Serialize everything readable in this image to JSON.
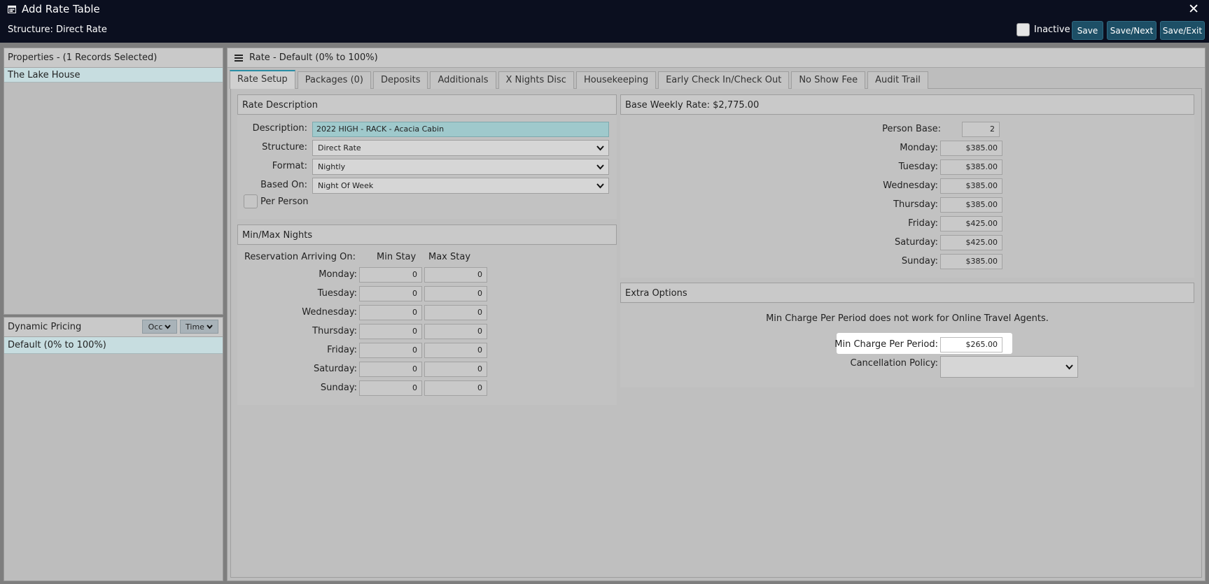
{
  "window": {
    "title": "Add Rate Table",
    "subtitle": "Structure: Direct Rate",
    "inactive_label": "Inactive",
    "buttons": {
      "save": "Save",
      "save_next": "Save/Next",
      "save_exit": "Save/Exit"
    }
  },
  "properties": {
    "header": "Properties - (1 Records Selected)",
    "items": [
      "The Lake House"
    ]
  },
  "dynamic_pricing": {
    "header": "Dynamic Pricing",
    "occ_label": "Occ",
    "time_label": "Time",
    "items": [
      "Default (0% to 100%)"
    ]
  },
  "main": {
    "header": "Rate - Default (0% to 100%)",
    "tabs": [
      "Rate Setup",
      "Packages (0)",
      "Deposits",
      "Additionals",
      "X Nights Disc",
      "Housekeeping",
      "Early Check In/Check Out",
      "No Show Fee",
      "Audit Trail"
    ]
  },
  "rate_description": {
    "header": "Rate Description",
    "description_label": "Description:",
    "description_value": "2022 HIGH - RACK - Acacia Cabin",
    "structure_label": "Structure:",
    "structure_value": "Direct Rate",
    "format_label": "Format:",
    "format_value": "Nightly",
    "based_on_label": "Based On:",
    "based_on_value": "Night Of Week",
    "per_person_label": "Per Person"
  },
  "min_max": {
    "header": "Min/Max Nights",
    "arriving_label": "Reservation Arriving On:",
    "min_label": "Min Stay",
    "max_label": "Max Stay",
    "rows": [
      {
        "day": "Monday:",
        "min": "0",
        "max": "0"
      },
      {
        "day": "Tuesday:",
        "min": "0",
        "max": "0"
      },
      {
        "day": "Wednesday:",
        "min": "0",
        "max": "0"
      },
      {
        "day": "Thursday:",
        "min": "0",
        "max": "0"
      },
      {
        "day": "Friday:",
        "min": "0",
        "max": "0"
      },
      {
        "day": "Saturday:",
        "min": "0",
        "max": "0"
      },
      {
        "day": "Sunday:",
        "min": "0",
        "max": "0"
      }
    ]
  },
  "base_weekly": {
    "header": "Base Weekly Rate: $2,775.00",
    "person_base_label": "Person Base:",
    "person_base_value": "2",
    "rows": [
      {
        "day": "Monday:",
        "rate": "$385.00"
      },
      {
        "day": "Tuesday:",
        "rate": "$385.00"
      },
      {
        "day": "Wednesday:",
        "rate": "$385.00"
      },
      {
        "day": "Thursday:",
        "rate": "$385.00"
      },
      {
        "day": "Friday:",
        "rate": "$425.00"
      },
      {
        "day": "Saturday:",
        "rate": "$425.00"
      },
      {
        "day": "Sunday:",
        "rate": "$385.00"
      }
    ]
  },
  "extra_options": {
    "header": "Extra Options",
    "note": "Min Charge Per Period does not work for Online Travel Agents.",
    "min_charge_label": "Min Charge Per Period:",
    "min_charge_value": "$265.00",
    "cancellation_label": "Cancellation Policy:",
    "cancellation_value": ""
  },
  "colors": {
    "titlebar": "#0b0f1f",
    "button": "#1d4f66",
    "selected_row": "#c7dde0",
    "active_tab_accent": "#2a8ea5"
  },
  "icons": {
    "title_icon": "calendar-icon",
    "close_icon": "close-icon",
    "menu_icon": "hamburger-icon"
  }
}
